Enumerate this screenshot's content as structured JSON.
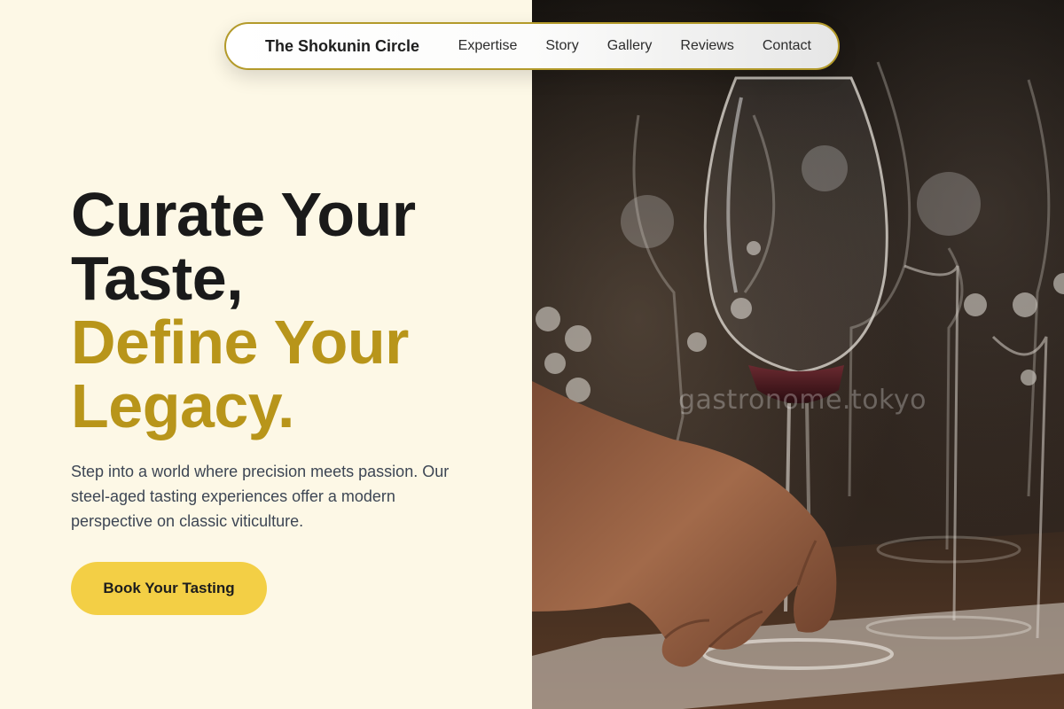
{
  "nav": {
    "brand": "The Shokunin Circle",
    "links": [
      "Expertise",
      "Story",
      "Gallery",
      "Reviews",
      "Contact"
    ]
  },
  "hero": {
    "title_line1": "Curate Your",
    "title_line2": "Taste,",
    "title_line3": "Define Your",
    "title_line4": "Legacy.",
    "description": "Step into a world where precision meets passion. Our steel-aged tasting experiences offer a modern perspective on classic viticulture.",
    "cta_label": "Book Your Tasting"
  },
  "photo": {
    "watermark": "gastronome.tokyo"
  },
  "colors": {
    "background": "#fdf8e6",
    "accent_gold": "#b8951a",
    "cta_yellow": "#f3cf45",
    "nav_border": "#b39a2a",
    "text_dark": "#1a1a1a",
    "text_body": "#3d4654"
  }
}
